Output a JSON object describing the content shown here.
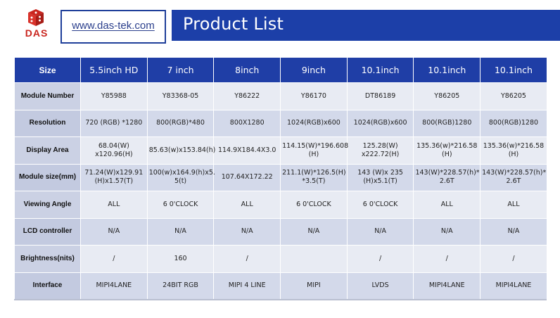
{
  "header": {
    "logo_text": "DAS",
    "website": "www.das-tek.com",
    "title": "Product List"
  },
  "colors": {
    "header_blue": "#1f3ea6",
    "banner_blue": "#1c3fa8",
    "logo_red": "#c9251e",
    "row_light": "#e8ebf3",
    "row_dark": "#d3d9ea"
  },
  "table": {
    "columns": [
      "Size",
      "5.5inch HD",
      "7 inch",
      "8inch",
      "9inch",
      "10.1inch",
      "10.1inch",
      "10.1inch"
    ],
    "rows": [
      {
        "label": "Module Number",
        "values": [
          "Y85988",
          "Y83368-05",
          "Y86222",
          "Y86170",
          "DT86189",
          "Y86205",
          "Y86205"
        ]
      },
      {
        "label": "Resolution",
        "values": [
          "720 (RGB) *1280",
          "800(RGB)*480",
          "800X1280",
          "1024(RGB)x600",
          "1024(RGB)x600",
          "800(RGB)1280",
          "800(RGB)1280"
        ]
      },
      {
        "label": "Display Area",
        "values": [
          "68.04(W) x120.96(H)",
          "85.63(w)x153.84(h)",
          "114.9X184.4X3.0",
          "114.15(W)*196.608 (H)",
          "125.28(W) x222.72(H)",
          "135.36(w)*216.58 (H)",
          "135.36(w)*216.58 (H)"
        ]
      },
      {
        "label": "Module size(mm)",
        "values": [
          "71.24(W)x129.91 (H)x1.57(T)",
          "100(w)x164.9(h)x5. 5(t)",
          "107.64X172.22",
          "211.1(W)*126.5(H) *3.5(T)",
          "143 (W)x 235 (H)x5.1(T)",
          "143(W)*228.57(h)* 2.6T",
          "143(W)*228.57(h)* 2.6T"
        ]
      },
      {
        "label": "Viewing Angle",
        "values": [
          "ALL",
          "6 0'CLOCK",
          "ALL",
          "6 0'CLOCK",
          "6 0'CLOCK",
          "ALL",
          "ALL"
        ]
      },
      {
        "label": "LCD controller",
        "values": [
          "N/A",
          "N/A",
          "N/A",
          "N/A",
          "N/A",
          "N/A",
          "N/A"
        ]
      },
      {
        "label": "Brightness(nits)",
        "values": [
          "/",
          "160",
          "/",
          "",
          "/",
          "/",
          "/"
        ]
      },
      {
        "label": "Interface",
        "values": [
          "MIPI4LANE",
          "24BIT RGB",
          "MIPI 4 LINE",
          "MIPI",
          "LVDS",
          "MIPI4LANE",
          "MIPI4LANE"
        ]
      }
    ]
  }
}
